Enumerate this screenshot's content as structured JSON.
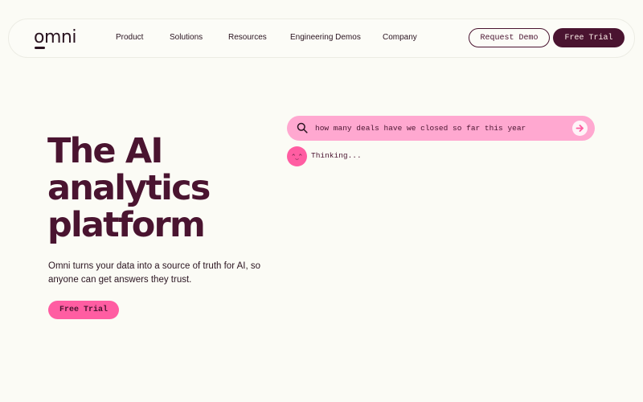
{
  "brand": {
    "logo_text": "omni"
  },
  "nav": {
    "links": [
      {
        "label": "Product"
      },
      {
        "label": "Solutions"
      },
      {
        "label": "Resources"
      },
      {
        "label": "Engineering Demos"
      },
      {
        "label": "Company"
      }
    ],
    "request_demo_label": "Request Demo",
    "free_trial_label": "Free Trial"
  },
  "hero": {
    "headline_line1": "The AI",
    "headline_line2": "analytics",
    "headline_line3": "platform",
    "subtitle": "Omni turns your data into a source of truth for AI, so anyone can get answers they trust.",
    "cta_label": "Free Trial"
  },
  "chat": {
    "query": "how many deals have we closed so far this year",
    "avatar_face": "^‿^",
    "status": "Thinking..."
  },
  "colors": {
    "background": "#fbfbf5",
    "brand_dark": "#4a1430",
    "accent_pink": "#ff5da2",
    "search_pink": "#ffa8d0"
  }
}
